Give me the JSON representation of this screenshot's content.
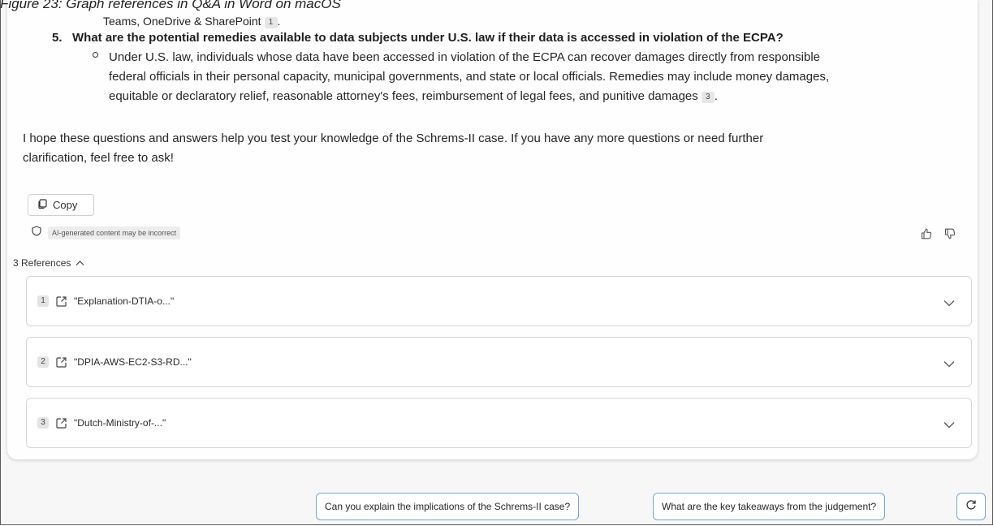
{
  "caption": "Figure 23: Graph references in Q&A in Word on macOS",
  "previous_line": {
    "text": "Teams, OneDrive & SharePoint",
    "citation": "1"
  },
  "question": {
    "number": "5.",
    "text": "What are the potential remedies available to data subjects under U.S. law if their data is accessed in violation of the ECPA?"
  },
  "answer": {
    "lines": [
      "Under U.S. law, individuals whose data have been accessed in violation of the ECPA can recover damages directly from responsible",
      "federal officials in their personal capacity, municipal governments, and state or local officials. Remedies may include money damages,",
      "equitable or declaratory relief, reasonable attorney's fees, reimbursement of legal fees, and punitive damages"
    ],
    "citation": "3",
    "end_punct": "."
  },
  "closing": {
    "lines": [
      "I hope these questions and answers help you test your knowledge of the Schrems-II case. If you have any more questions or need further",
      "clarification, feel free to ask!"
    ]
  },
  "actions": {
    "copy_label": "Copy",
    "ai_disclaimer": "AI-generated content may be incorrect"
  },
  "references": {
    "toggle_label": "3 References",
    "items": [
      {
        "num": "1",
        "title": "\"Explanation-DTIA-o...\""
      },
      {
        "num": "2",
        "title": "\"DPIA-AWS-EC2-S3-RD...\""
      },
      {
        "num": "3",
        "title": "\"Dutch-Ministry-of-...\""
      }
    ]
  },
  "suggestions": [
    "Can you explain the implications of the Schrems-II case?",
    "What are the key takeaways from the judgement?"
  ],
  "icons": {
    "copy": "copy-icon",
    "shield": "shield-icon",
    "thumbs_up": "thumbs-up-icon",
    "thumbs_down": "thumbs-down-icon",
    "chevron_up": "chevron-up-icon",
    "chevron_down": "chevron-down-icon",
    "external_link": "external-link-icon",
    "refresh": "refresh-icon"
  },
  "colors": {
    "suggestion_border": "#7aa3d6",
    "card_bg": "#fefefe",
    "panel_bg": "#f7f7f7"
  }
}
